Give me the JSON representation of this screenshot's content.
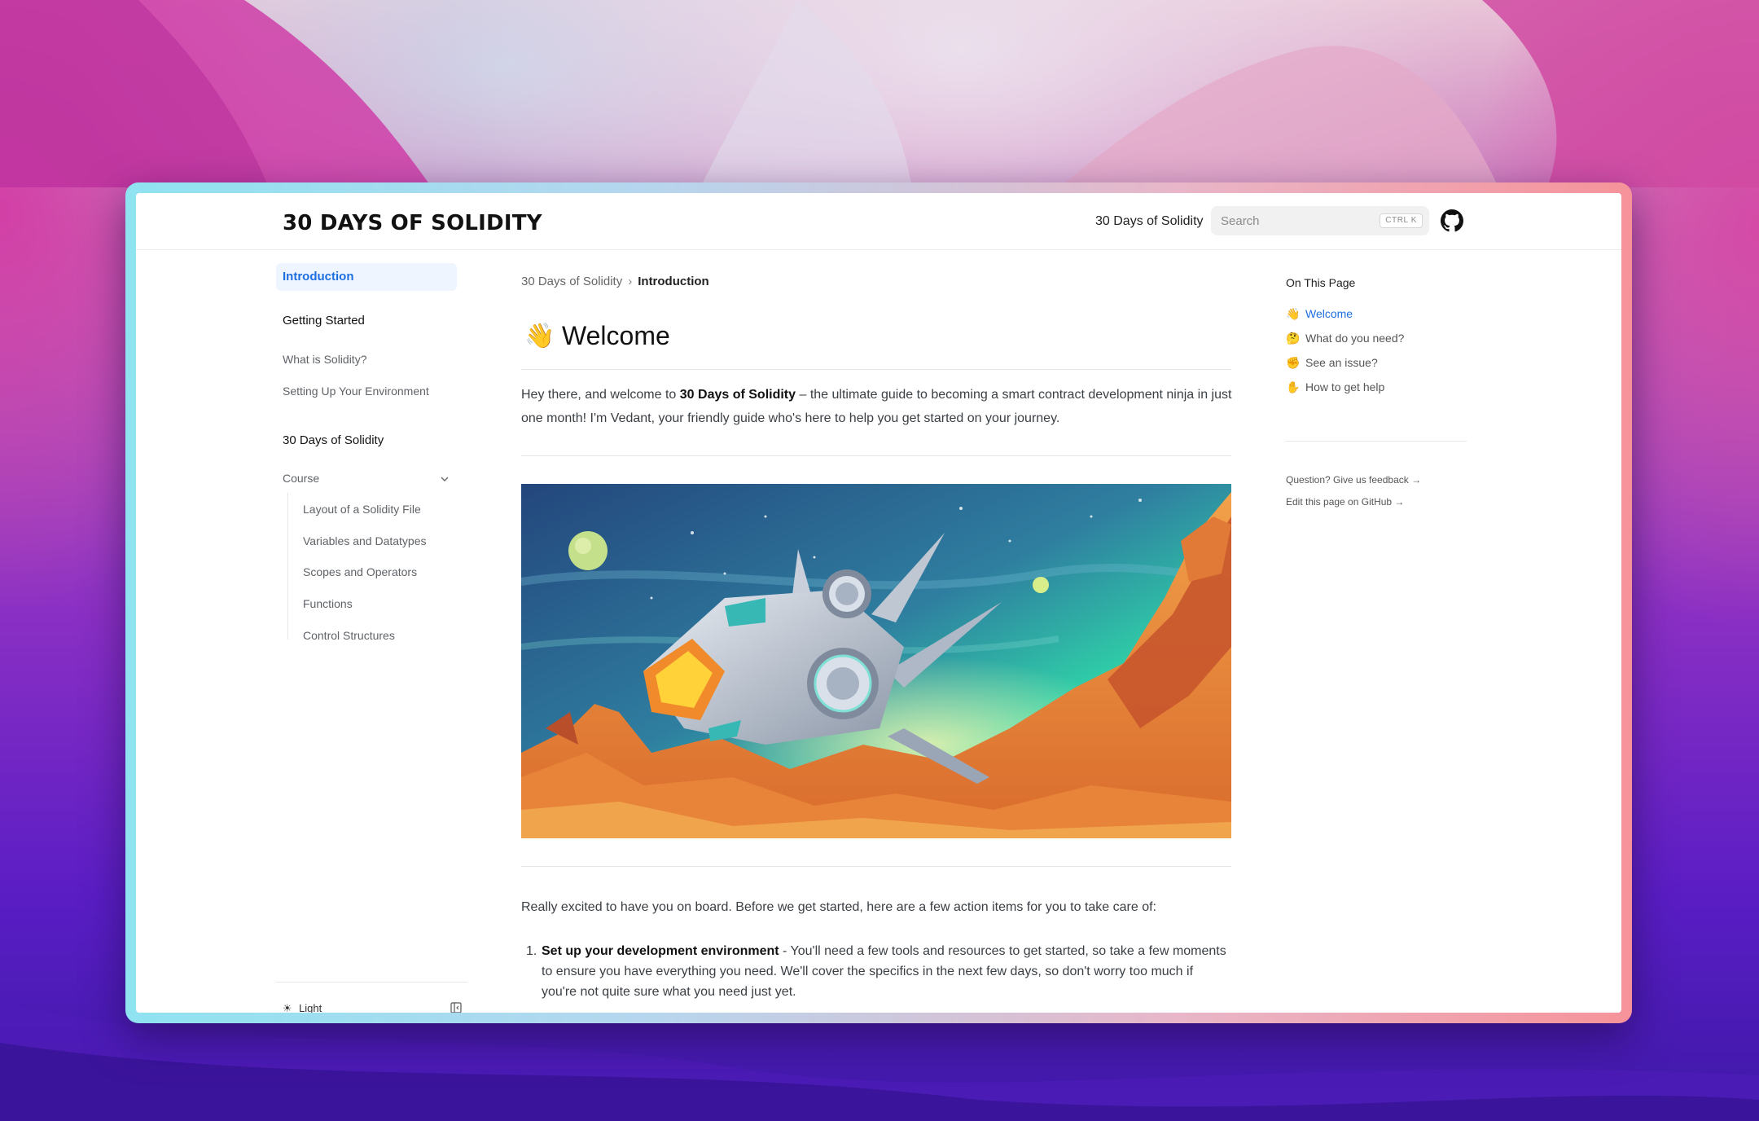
{
  "colors": {
    "accent": "#1d6fe0",
    "frame_left": "#8fe3f1",
    "frame_right": "#f6939a"
  },
  "header": {
    "logo": "30 DAYS OF SOLIDITY",
    "nav_link": "30 Days of Solidity",
    "search_placeholder": "Search",
    "search_shortcut": "CTRL K",
    "github_icon": "github-icon"
  },
  "sidebar": {
    "active_item": "Introduction",
    "getting_started": {
      "heading": "Getting Started",
      "items": [
        "What is Solidity?",
        "Setting Up Your Environment"
      ]
    },
    "course_section": {
      "heading": "30 Days of Solidity",
      "course_label": "Course",
      "course_items": [
        "Layout of a Solidity File",
        "Variables and Datatypes",
        "Scopes and Operators",
        "Functions",
        "Control Structures"
      ]
    },
    "theme_label": "Light"
  },
  "breadcrumb": {
    "root": "30 Days of Solidity",
    "current": "Introduction"
  },
  "main": {
    "title_emoji": "👋",
    "title": "Welcome",
    "intro_part1": "Hey there, and welcome to ",
    "intro_bold": "30 Days of Solidity",
    "intro_part2": " – the ultimate guide to becoming a smart contract development ninja in just one month! I'm Vedant, your friendly guide who's here to help you get started on your journey.",
    "para2": "Really excited to have you on board. Before we get started, here are a few action items for you to take care of:",
    "list": [
      {
        "num": "1.",
        "bold": "Set up your development environment",
        "text": " - You'll need a few tools and resources to get started, so take a few moments to ensure you have everything you need. We'll cover the specifics in the next few days, so don't worry too much if you're not quite sure what you need just yet."
      }
    ]
  },
  "toc": {
    "title": "On This Page",
    "items": [
      {
        "emoji": "👋",
        "label": "Welcome",
        "active": true
      },
      {
        "emoji": "🤔",
        "label": "What do you need?"
      },
      {
        "emoji": "✊",
        "label": "See an issue?"
      },
      {
        "emoji": "✋",
        "label": "How to get help"
      }
    ],
    "feedback_link": "Question? Give us feedback →",
    "edit_link": "Edit this page on GitHub →"
  }
}
